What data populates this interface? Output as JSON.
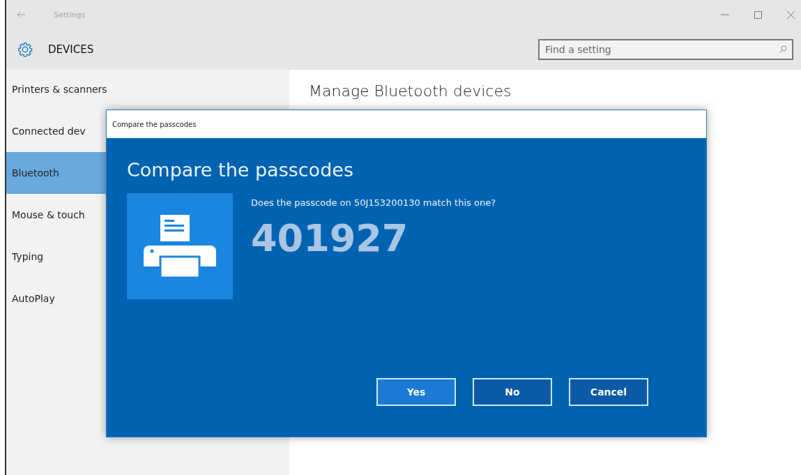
{
  "window": {
    "title": "Settings"
  },
  "header": {
    "title": "DEVICES",
    "search": {
      "placeholder": "Find a setting"
    }
  },
  "sidebar": {
    "items": [
      {
        "label": "Printers & scanners",
        "selected": false
      },
      {
        "label": "Connected dev",
        "selected": false
      },
      {
        "label": "Bluetooth",
        "selected": true
      },
      {
        "label": "Mouse & touch",
        "selected": false
      },
      {
        "label": "Typing",
        "selected": false
      },
      {
        "label": "AutoPlay",
        "selected": false
      }
    ]
  },
  "content": {
    "heading": "Manage Bluetooth devices"
  },
  "dialog": {
    "title": "Compare the passcodes",
    "heading": "Compare the passcodes",
    "question": "Does the passcode on 50J153200130 match this one?",
    "passcode": "401927",
    "buttons": [
      {
        "label": "Yes",
        "focused": true
      },
      {
        "label": "No",
        "focused": false
      },
      {
        "label": "Cancel",
        "focused": false
      }
    ]
  }
}
